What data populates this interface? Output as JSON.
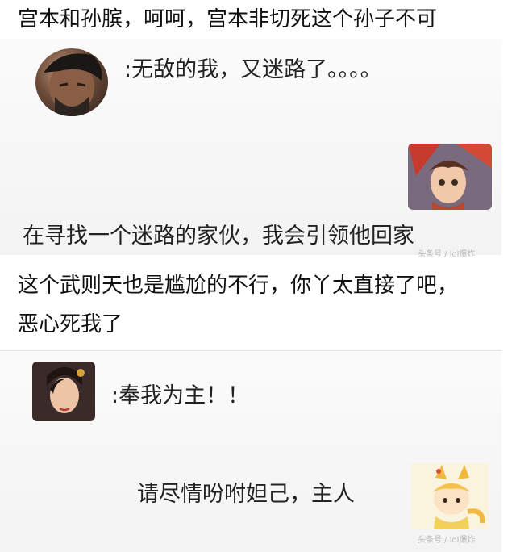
{
  "captions": {
    "top": "宫本和孙膑，呵呵，宫本非切死这个孙子不可",
    "middle_line1": "这个武则天也是尴尬的不行，你丫太直接了吧，",
    "middle_line2": "恶心死我了"
  },
  "chat1": {
    "left_message": ":无敌的我，又迷路了。。。。",
    "right_message": "在寻找一个迷路的家伙，我会引领他回家",
    "watermark": "头条号 / lol爆炸"
  },
  "chat2": {
    "left_message": ":奉我为主！！",
    "right_message": "请尽情吩咐妲己，主人",
    "watermark": "头条号 / lol爆炸"
  },
  "icons": {
    "avatar1": "miyamoto-avatar-icon",
    "avatar2": "sun-bin-avatar-icon",
    "avatar3": "wu-zetian-avatar-icon",
    "avatar4": "daji-avatar-icon"
  }
}
